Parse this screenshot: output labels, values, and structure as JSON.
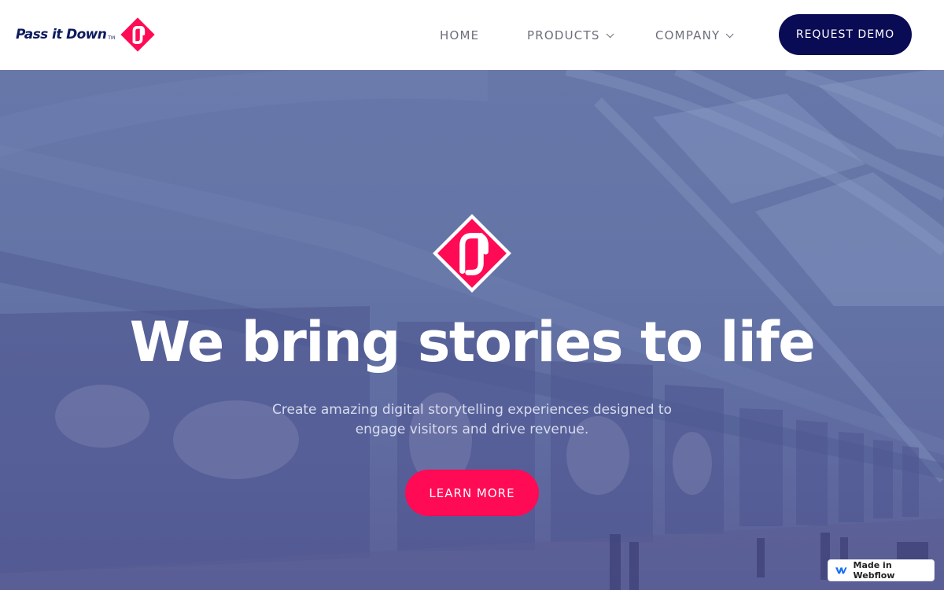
{
  "brand": {
    "name": "Pass it Down",
    "tm": "TM",
    "accent_color": "#ff0a55",
    "navy_color": "#0a0b55"
  },
  "nav": {
    "items": [
      {
        "label": "HOME",
        "has_dropdown": false
      },
      {
        "label": "PRODUCTS",
        "has_dropdown": true
      },
      {
        "label": "COMPANY",
        "has_dropdown": true
      }
    ],
    "cta_label": "REQUEST DEMO"
  },
  "hero": {
    "title": "We bring stories to life",
    "subtitle": "Create amazing digital storytelling experiences designed to engage visitors and drive revenue.",
    "cta_label": "LEARN MORE",
    "background": "museum-gallery-photo"
  },
  "badge": {
    "label": "Made in Webflow",
    "icon": "webflow-icon"
  }
}
